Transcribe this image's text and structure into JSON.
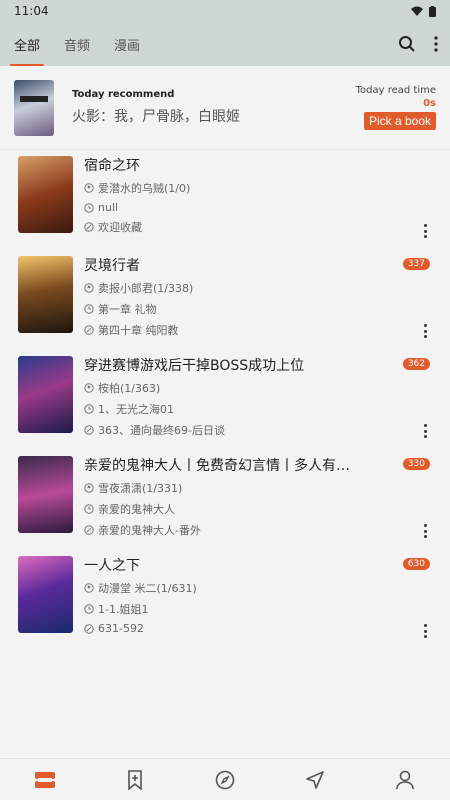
{
  "status": {
    "time": "11:04"
  },
  "tabs": [
    "全部",
    "音频",
    "漫画"
  ],
  "recommend": {
    "label": "Today recommend",
    "title": "火影：我，尸骨脉，白眼姬",
    "read_time_label": "Today read time",
    "read_time_value": "0s",
    "pick_button": "Pick a book"
  },
  "books": [
    {
      "title": "宿命之环",
      "author": "爱潜水的乌贼(1/0)",
      "last_read": "null",
      "latest": "欢迎收藏",
      "badge": "",
      "cover_color": "#7a3b1c"
    },
    {
      "title": "灵境行者",
      "author": "卖报小郎君(1/338)",
      "last_read": "第一章 礼物",
      "latest": "第四十章 纯阳教",
      "badge": "337",
      "cover_color": "#2b2418"
    },
    {
      "title": "穿进赛博游戏后干掉BOSS成功上位",
      "author": "桉柏(1/363)",
      "last_read": "1、无光之海01",
      "latest": "363、通向最终69-后日谈",
      "badge": "362",
      "cover_color": "#1b2d6b"
    },
    {
      "title": "亲爱的鬼神大人丨免费奇幻言情丨多人有声剧",
      "author": "雪夜潇潇(1/331)",
      "last_read": "亲爱的鬼神大人",
      "latest": "亲爱的鬼神大人-番外",
      "badge": "330",
      "cover_color": "#5a2a5c"
    },
    {
      "title": "一人之下",
      "author": "动漫堂 米二(1/631)",
      "last_read": "1-1.姐姐1",
      "latest": "631-592",
      "badge": "630",
      "cover_color": "#4b2d7a"
    }
  ],
  "colors": {
    "accent": "#e25b2d",
    "header_bg": "#cfd7d2"
  }
}
